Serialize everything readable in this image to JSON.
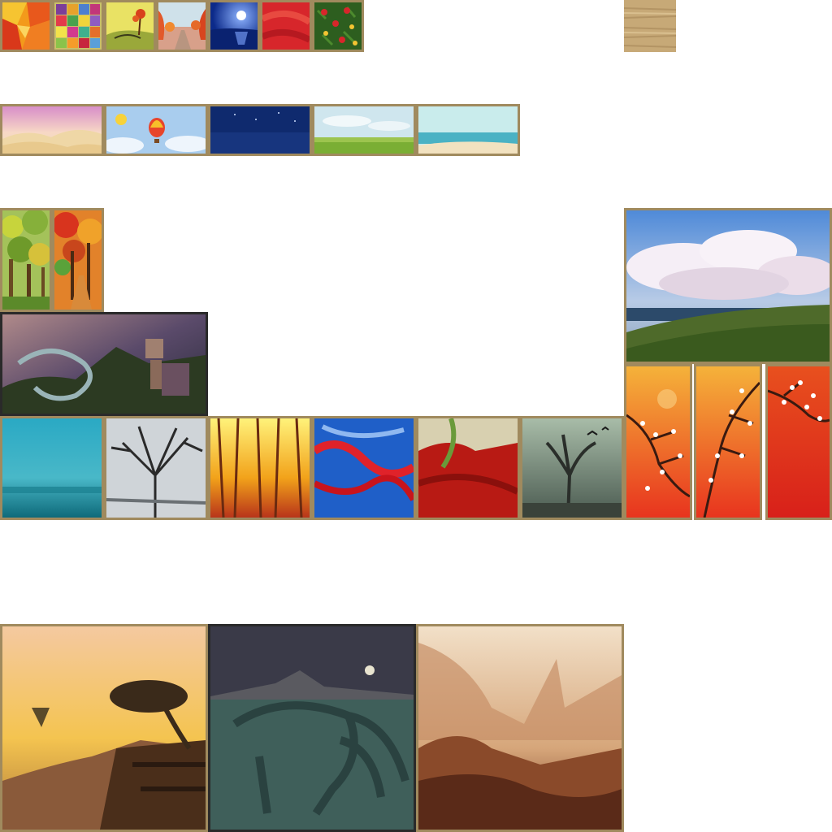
{
  "atlas": {
    "rows": [
      {
        "name": "small-square-paintings",
        "items": [
          "warm-abstract",
          "color-grid",
          "yellow-landscape",
          "autumn-road",
          "moonlit-sea",
          "red-abstract",
          "red-flowers"
        ]
      },
      {
        "name": "wide-paintings",
        "items": [
          "pink-dunes",
          "hot-air-balloon",
          "night-sea",
          "meadow",
          "beach"
        ]
      },
      {
        "name": "medium-paintings",
        "items": [
          "green-forest",
          "autumn-forest",
          "dragon-warrior",
          "cloud-landscape",
          "teal-fog",
          "grey-tree",
          "golden-forest",
          "blue-red-abstract",
          "red-swirl",
          "dead-tree-bats",
          "cherry-blossom-left",
          "cherry-blossom-middle",
          "cherry-blossom-right"
        ]
      },
      {
        "name": "large-paintings",
        "items": [
          "floating-island",
          "mammoth-lake",
          "sepia-canyon"
        ]
      }
    ],
    "frame_color": "#a08a5e",
    "background_color": "#ffffff"
  }
}
